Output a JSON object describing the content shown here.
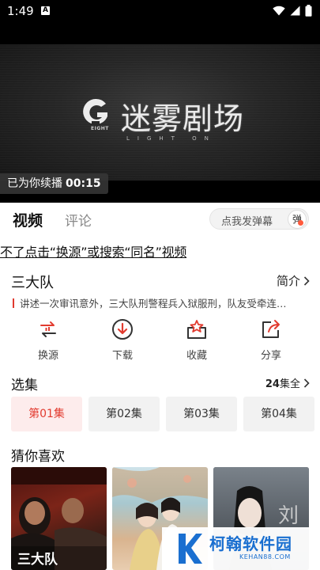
{
  "statusbar": {
    "time": "1:49",
    "badge": "A",
    "icons": [
      "wifi-icon",
      "signal-icon",
      "battery-icon"
    ]
  },
  "player": {
    "logo_title": "迷雾剧场",
    "logo_sub": "LIGHT ON",
    "logo_eight": "EIGHT",
    "resume_label": "已为你续播",
    "resume_time": "00:15"
  },
  "tabs": {
    "video": "视频",
    "comments": "评论",
    "danmu_placeholder": "点我发弹幕",
    "danmu_icon": "弹"
  },
  "notice": "不了点击“换源”或搜索“同名”视频",
  "show": {
    "title": "三大队",
    "intro_label": "简介",
    "description": "讲述一次审讯意外，三大队刑警程兵入狱服刑，队友受牵连…"
  },
  "actions": [
    {
      "label": "换源",
      "icon": "switch-source-icon"
    },
    {
      "label": "下载",
      "icon": "download-icon"
    },
    {
      "label": "收藏",
      "icon": "favorite-icon"
    },
    {
      "label": "分享",
      "icon": "share-icon"
    }
  ],
  "episodes": {
    "label": "选集",
    "total_count": "24",
    "total_suffix": "集全",
    "items": [
      "第01集",
      "第02集",
      "第03集",
      "第04集"
    ],
    "active_index": 0
  },
  "recommend": {
    "label": "猜你喜欢",
    "poster_texts": [
      "三大队",
      "刘"
    ]
  },
  "watermark": {
    "text": "柯翰软件园",
    "url": "KEHAN88.COM"
  },
  "colors": {
    "accent": "#e23b2f",
    "watermark": "#1a6fd0"
  }
}
